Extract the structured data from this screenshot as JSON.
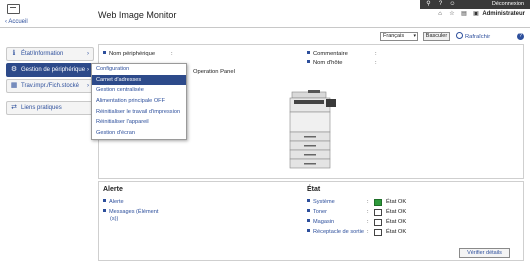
{
  "header": {
    "app_title": "Web Image Monitor",
    "home_link": "Accueil",
    "disconnect": "Déconnexion",
    "user": "Administrateur"
  },
  "controls": {
    "language": "Français",
    "switch_button": "Basculer",
    "refresh": "Rafraîchir"
  },
  "sidebar": {
    "items": [
      {
        "label": "État/Information",
        "icon": "info-icon"
      },
      {
        "label": "Gestion de périphérique",
        "icon": "device-gear-icon"
      },
      {
        "label": "Trav.impr./Fich.stocké",
        "icon": "print-jobs-icon"
      },
      {
        "label": "Liens pratiques",
        "icon": "links-icon"
      }
    ]
  },
  "dropdown": {
    "items": [
      "Configuration",
      "Carnet d'adresses",
      "Gestion centralisée",
      "Alimentation principale OFF",
      "Réinitialiser le travail d'impression",
      "Réinitialiser l'appareil",
      "Gestion d'écran"
    ]
  },
  "device_info": {
    "name_label": "Nom périphérique",
    "name_value": ":",
    "operation_panel": "Operation Panel",
    "comment_label": "Commentaire",
    "comment_value": ":",
    "host_label": "Nom d'hôte",
    "host_value": ":"
  },
  "alerts": {
    "title": "Alerte",
    "links": [
      "Alerte",
      "Messages (Élément",
      "(s))"
    ]
  },
  "status": {
    "title": "État",
    "rows": [
      {
        "label": "Système",
        "value": "État OK",
        "icon": "system-ok-icon"
      },
      {
        "label": "Toner",
        "value": "État OK",
        "icon": "toner-icon"
      },
      {
        "label": "Magasin",
        "value": "État OK",
        "icon": "tray-icon"
      },
      {
        "label": "Réceptacle de sortie",
        "value": "État OK",
        "icon": "output-tray-icon"
      }
    ],
    "verify_button": "Vérifier détails"
  },
  "colors": {
    "accent": "#2d4a8a",
    "link": "#2d4f9c",
    "ok": "#2e9a3b",
    "topbar_dark": "#3a3a3a"
  }
}
